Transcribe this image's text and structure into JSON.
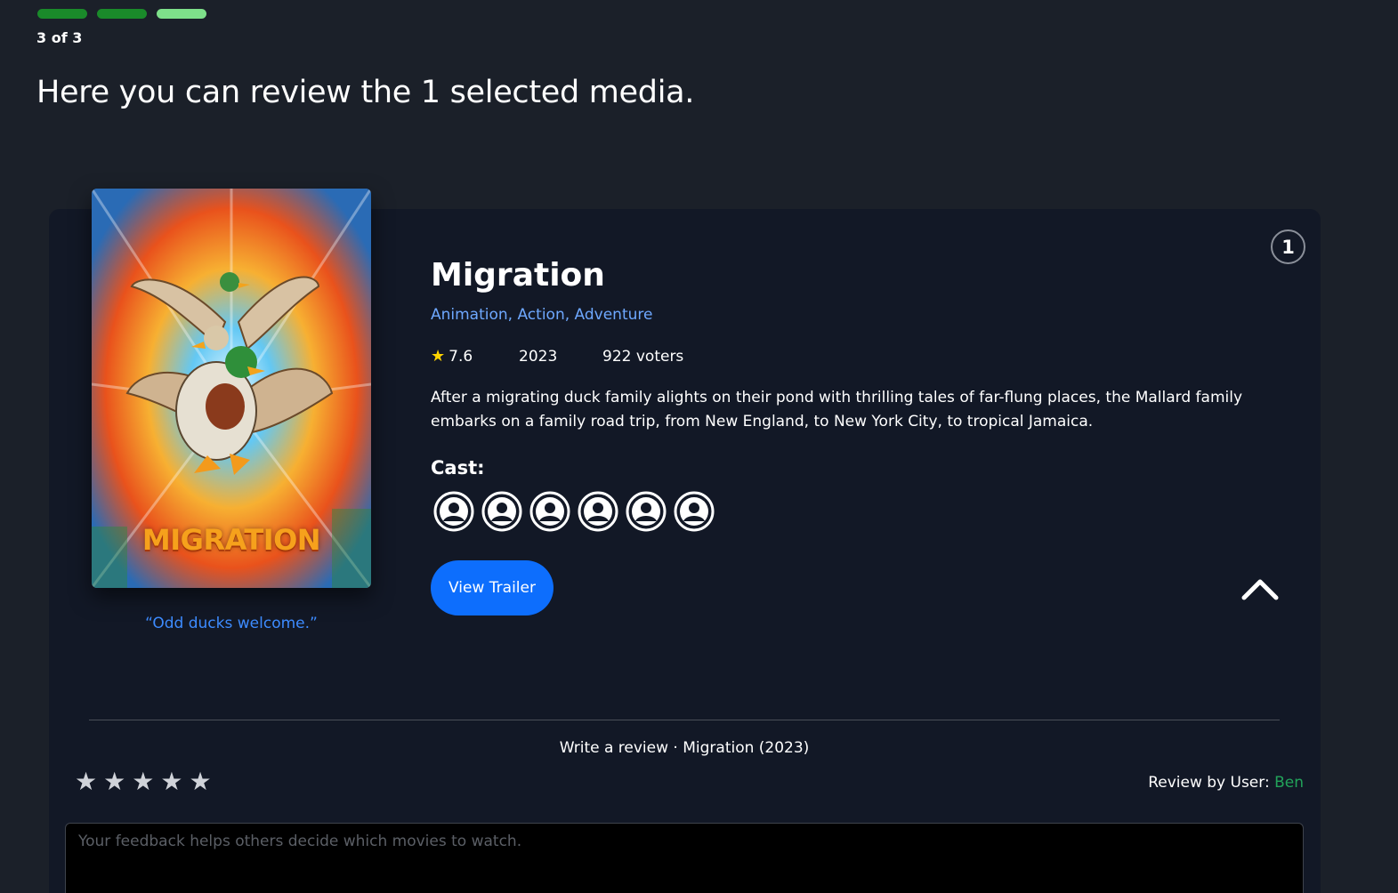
{
  "stepper": {
    "total": 3,
    "current": 3,
    "label": "3 of 3"
  },
  "page_title": "Here you can review the 1 selected media.",
  "movie": {
    "index": "1",
    "title": "Migration",
    "genres": "Animation, Action, Adventure",
    "rating": "7.6",
    "year": "2023",
    "voters": "922 voters",
    "overview": "After a migrating duck family alights on their pond with thrilling tales of far-flung places, the Mallard family embarks on a family road trip, from New England, to New York City, to tropical Jamaica.",
    "tagline": "“Odd ducks welcome.”",
    "poster_title": "MIGRATION",
    "cast_label": "Cast:",
    "cast_count": 6,
    "trailer_label": "View Trailer"
  },
  "review": {
    "heading": "Write a review · Migration (2023)",
    "stars": [
      "★",
      "★",
      "★",
      "★",
      "★"
    ],
    "by_label": "Review by User:",
    "user": "Ben",
    "placeholder": "Your feedback helps others decide which movies to watch."
  },
  "colors": {
    "background": "#1b2029",
    "card": "#121826",
    "accent_blue": "#0d6efd",
    "genre_blue": "#6ea8ff",
    "user_green": "#22a35a",
    "star_yellow": "#ffd400"
  },
  "icons": {
    "rating": "star-icon",
    "cast": "user-avatar-icon",
    "collapse": "chevron-up-icon"
  }
}
